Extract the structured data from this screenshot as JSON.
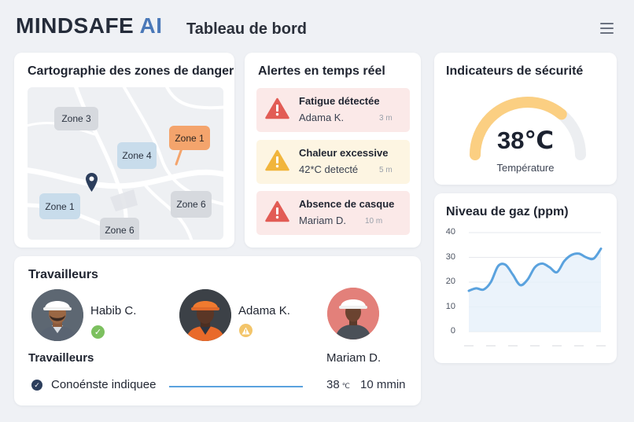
{
  "header": {
    "brand_part1": "MINDSAFE",
    "brand_part2": "AI",
    "page_title": "Tableau de bord"
  },
  "map_card": {
    "title": "Cartographie des zones de danger",
    "zones": [
      "Zone 3",
      "Zone 1",
      "Zone 4",
      "Zone 1",
      "Zone 6",
      "Zone 6"
    ]
  },
  "alerts_card": {
    "title": "Alertes en temps réel",
    "alerts": [
      {
        "title": "Fatigue détectée",
        "subtitle": "Adama K.",
        "time": "3 m",
        "level": "danger"
      },
      {
        "title": "Chaleur excessive",
        "subtitle": "42*C detecté",
        "time": "5 m",
        "level": "warning"
      },
      {
        "title": "Absence de casque",
        "subtitle": "Mariam D.",
        "time": "10 m",
        "level": "danger"
      }
    ]
  },
  "safety_card": {
    "title": "Indicateurs de sécurité",
    "gauge_value": "38℃",
    "gauge_label": "Température",
    "gauge_level": 0.72
  },
  "workers_card": {
    "title": "Travailleurs",
    "workers": [
      {
        "name": "Habib C.",
        "status": "ok"
      },
      {
        "name": "Adama K.",
        "status": "warning"
      },
      {
        "name": "Mariam D.",
        "status": ""
      }
    ],
    "subtitle": "Travailleurs",
    "row_label": "Conoénste indiquee",
    "row_temp": "38",
    "row_temp_unit": "℃",
    "row_duration": "10 mmin"
  },
  "gas_card": {
    "title": "Niveau de gaz (ppm)"
  },
  "chart_data": {
    "type": "line",
    "title": "Niveau de gaz (ppm)",
    "yticks": [
      "40",
      "30",
      "20",
      "10",
      "0"
    ],
    "ylim": [
      0,
      40
    ],
    "grid": true,
    "x": [
      0,
      1,
      2,
      3,
      4,
      5,
      6,
      7,
      8,
      9,
      10,
      11,
      12,
      13,
      14,
      15,
      16,
      17,
      18
    ],
    "values": [
      16.5,
      17.5,
      17,
      20,
      26.5,
      27,
      23,
      18.8,
      21,
      26,
      27.5,
      26,
      24,
      28.5,
      31,
      31.5,
      30,
      29.5,
      33.5
    ],
    "colors": {
      "line": "#5aa2de",
      "fill": "#e6f0fa"
    }
  },
  "colors": {
    "brand_dark": "#252c3a",
    "brand_accent": "#4a78b8",
    "danger": "#e25c55",
    "warning": "#f1b53c",
    "ok": "#7cc05f",
    "gauge_track": "#eceef1",
    "gauge_fill": "#fbcf82"
  }
}
